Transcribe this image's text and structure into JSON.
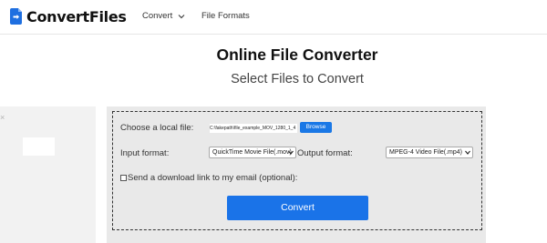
{
  "header": {
    "logo_text": "ConvertFiles",
    "nav": {
      "convert_label": "Convert",
      "file_formats_label": "File Formats"
    }
  },
  "main": {
    "title": "Online File Converter",
    "subtitle": "Select Files to Convert"
  },
  "sidebar": {
    "close_glyph": "×"
  },
  "form": {
    "local_file_label": "Choose a local file:",
    "file_path_value": "C:\\fakepath\\file_example_MOV_1280_1_4",
    "browse_label": "Browse",
    "input_format_label": "Input format:",
    "input_format_value": "QuickTime Movie File(.mov)",
    "output_format_label": "Output format:",
    "output_format_value": "MPEG-4 Video File(.mp4)",
    "email_checkbox_label": "Send a download link to my email (optional):",
    "email_checked": false,
    "convert_label": "Convert"
  },
  "colors": {
    "accent": "#1a73e8",
    "logo_blue": "#1e6fe0",
    "panel_gray": "#e9e9e9"
  },
  "icons": {
    "logo": "file-convert-icon",
    "nav_dropdown": "chevron-down-icon",
    "select_arrow": "chevron-down-icon"
  }
}
